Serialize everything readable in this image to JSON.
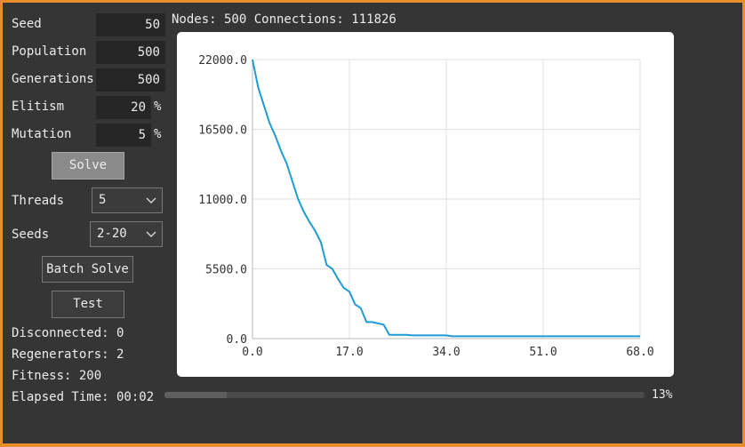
{
  "params": {
    "seed": {
      "label": "Seed",
      "value": "50"
    },
    "population": {
      "label": "Population",
      "value": "500"
    },
    "generations": {
      "label": "Generations",
      "value": "500"
    },
    "elitism": {
      "label": "Elitism",
      "value": "20",
      "unit": "%"
    },
    "mutation": {
      "label": "Mutation",
      "value": "5",
      "unit": "%"
    }
  },
  "solve_label": "Solve",
  "threads": {
    "label": "Threads",
    "value": "5"
  },
  "seeds": {
    "label": "Seeds",
    "value": "2-20"
  },
  "batch_solve_label": "Batch Solve",
  "test_label": "Test",
  "stats": {
    "disconnected": "Disconnected: 0",
    "regenerators": "Regenerators: 2",
    "fitness": "Fitness: 200",
    "elapsed": "Elapsed Time: 00:02"
  },
  "header": "Nodes: 500 Connections: 111826",
  "progress": {
    "fraction": 0.13,
    "label": "13%"
  },
  "chart_data": {
    "type": "line",
    "title": "",
    "xlabel": "",
    "ylabel": "",
    "xlim": [
      0,
      68
    ],
    "ylim": [
      0,
      22000
    ],
    "xticks": [
      "0.0",
      "17.0",
      "34.0",
      "51.0",
      "68.0"
    ],
    "yticks": [
      "0.0",
      "5500.0",
      "11000.0",
      "16500.0",
      "22000.0"
    ],
    "grid": true,
    "color": "#1f9bd7",
    "series": [
      {
        "x": [
          0,
          1,
          2,
          3,
          4,
          5,
          6,
          7,
          8,
          9,
          10,
          11,
          12,
          13,
          14,
          15,
          16,
          17,
          18,
          19,
          20,
          21,
          22,
          23,
          24,
          25,
          26,
          27,
          28,
          29,
          30,
          31,
          32,
          33,
          34,
          35,
          36,
          37,
          38,
          40,
          45,
          50,
          55,
          60,
          65,
          68
        ],
        "y": [
          22000,
          19800,
          18400,
          17000,
          16000,
          14800,
          13800,
          12400,
          11000,
          10000,
          9200,
          8500,
          7600,
          5800,
          5500,
          4700,
          4000,
          3700,
          2700,
          2400,
          1300,
          1300,
          1200,
          1100,
          300,
          300,
          300,
          300,
          250,
          250,
          250,
          250,
          250,
          250,
          250,
          180,
          180,
          180,
          180,
          180,
          180,
          180,
          180,
          180,
          180,
          180
        ]
      }
    ]
  }
}
